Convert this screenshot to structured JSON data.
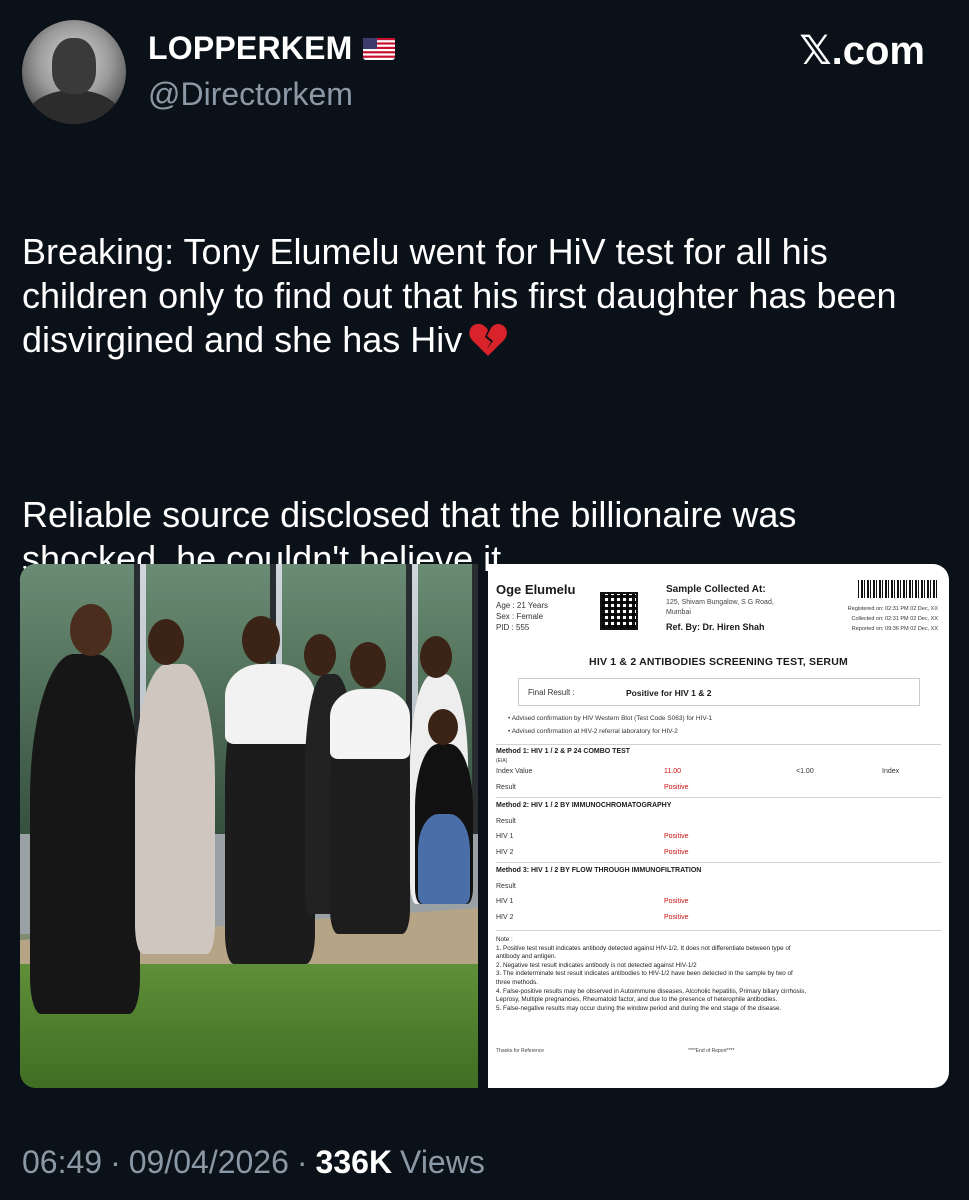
{
  "header": {
    "display_name": "LOPPERKEM",
    "handle": "@Directorkem",
    "brand": "𝕏.com"
  },
  "tweet": {
    "paragraph_1": "Breaking: Tony Elumelu went for HiV test for all his children only to find out that his first daughter has been disvirgined and she has Hiv",
    "paragraph_2": "Reliable source disclosed that the billionaire was shocked, he couldn't believe it."
  },
  "report": {
    "patient_name": "Oge Elumelu",
    "patient_meta": "Age : 21 Years\nSex : Female\nPID : 555",
    "sample_heading": "Sample Collected At:",
    "sample_address": "125, Shivam Bungalow, S G Road,\nMumbai",
    "ref_by": "Ref. By: Dr. Hiren Shah",
    "dates": "Registered on: 02:31 PM 02 Dec, XX\nCollected on: 02:31 PM 02 Dec, XX\nReported on: 09:36 PM 02 Dec, XX",
    "title": "HIV 1 & 2 ANTIBODIES SCREENING TEST, SERUM",
    "final_label": "Final Result :",
    "final_value": "Positive for HIV 1 & 2",
    "advised": "•  Advised confirmation by HIV Western Blot (Test Code S063) for HIV-1\n•  Advised confirmation at HIV-2 referral laboratory for HIV-2",
    "method1": {
      "heading": "Method 1: HIV 1 / 2 & P 24 COMBO TEST",
      "sub": "(EIA)",
      "index_label": "Index Value",
      "index_value": "11.00",
      "ref_range": "<1.00",
      "unit": "Index",
      "result_label": "Result",
      "result_value": "Positive"
    },
    "method2": {
      "heading": "Method 2: HIV 1 / 2 BY IMMUNOCHROMATOGRAPHY",
      "result_label": "Result",
      "hiv1_label": "HIV 1",
      "hiv1_value": "Positive",
      "hiv2_label": "HIV 2",
      "hiv2_value": "Positive"
    },
    "method3": {
      "heading": "Method 3: HIV 1 / 2 BY FLOW THROUGH IMMUNOFILTRATION",
      "result_label": "Result",
      "hiv1_label": "HIV 1",
      "hiv1_value": "Positive",
      "hiv2_label": "HIV 2",
      "hiv2_value": "Positive"
    },
    "notes": "Note :\n1. Positive test result indicates antibody detected against HIV-1/2. It does not differentiate between type of\n    antibody and antigen.\n2. Negative test result indicates antibody is not detected against HIV-1/2\n3. The indeterminate test result indicates antibodies to HIV-1/2 have been detected in the sample by two of\n    three methods.\n4. False-positive results may be observed in Autoimmune diseases, Alcoholic hepatitis, Primary biliary cirrhosis,\n    Leprosy, Multiple pregnancies, Rheumatoid factor, and due to the presence of heterophile antibodies.\n5. False-negative results may occur during the window period and during the end stage of the disease.",
    "thanks": "Thanks for Reference",
    "end": "****End of Report****"
  },
  "footer": {
    "time": "06:49",
    "date": "09/04/2026",
    "views_count": "336K",
    "views_label": "Views",
    "separator": "·"
  },
  "colors": {
    "background": "#0b1118",
    "muted_text": "#8b98a5",
    "positive_red": "#cc1111"
  },
  "icons": [
    "us-flag-icon",
    "broken-heart-icon"
  ]
}
